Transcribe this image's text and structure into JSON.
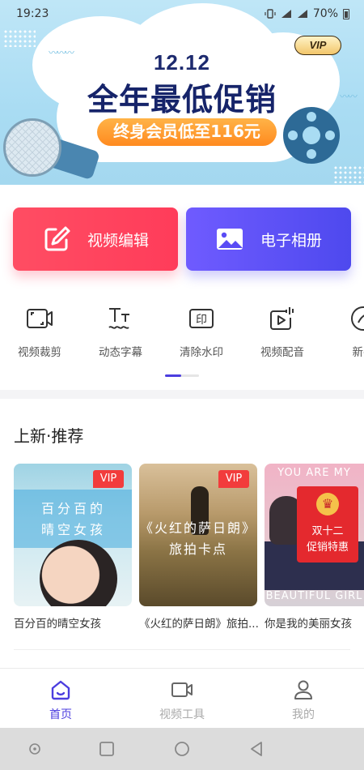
{
  "status_bar": {
    "time": "19:23",
    "battery": "70%",
    "network": "4G"
  },
  "banner": {
    "vip": "VIP",
    "date": "12.12",
    "title": "全年最低促销",
    "subtitle": "终身会员低至116元"
  },
  "quick_actions": [
    {
      "label": "视频编辑",
      "icon": "edit-icon",
      "color": "#ff4560"
    },
    {
      "label": "电子相册",
      "icon": "image-icon",
      "color": "#5a4cf5"
    }
  ],
  "tools": [
    {
      "label": "视频裁剪",
      "icon": "crop-video-icon"
    },
    {
      "label": "动态字幕",
      "icon": "subtitle-icon"
    },
    {
      "label": "清除水印",
      "icon": "watermark-icon"
    },
    {
      "label": "视频配音",
      "icon": "dubbing-icon"
    },
    {
      "label": "新手",
      "icon": "tutorial-icon"
    }
  ],
  "section": {
    "title": "上新·推荐"
  },
  "cards": [
    {
      "caption": "百分百的晴空女孩",
      "vip": "VIP",
      "art_lines": [
        "百分百的",
        "晴空女孩"
      ]
    },
    {
      "caption": "《火红的萨日朗》旅拍...",
      "vip": "VIP",
      "art_lines": [
        "《火红的萨日朗》",
        "旅拍卡点"
      ]
    },
    {
      "caption": "你是我的美丽女孩",
      "art_top": "YOU ARE MY",
      "art_bottom": "BEAUTIFUL GIRL",
      "envelope_lines": [
        "双十二",
        "促销特惠"
      ]
    }
  ],
  "tabbar": [
    {
      "label": "首页",
      "icon": "home-icon",
      "active": true
    },
    {
      "label": "视频工具",
      "icon": "video-camera-icon",
      "active": false
    },
    {
      "label": "我的",
      "icon": "profile-icon",
      "active": false
    }
  ],
  "colors": {
    "accent": "#4b3ddf",
    "vip_red": "#f23c3c",
    "banner_sky": "#a9dcf3"
  }
}
